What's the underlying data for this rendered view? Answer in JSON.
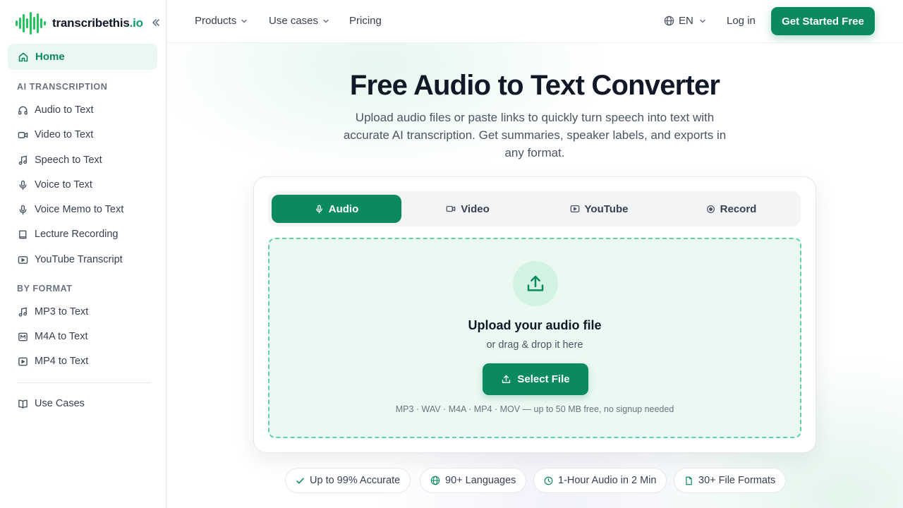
{
  "brand": {
    "name": "transcribethis",
    "tld": ".io"
  },
  "sidebar": {
    "home": "Home",
    "sections": [
      {
        "title": "AI TRANSCRIPTION",
        "items": [
          "Audio to Text",
          "Video to Text",
          "Speech to Text",
          "Voice to Text",
          "Voice Memo to Text",
          "Lecture Recording",
          "YouTube Transcript"
        ]
      },
      {
        "title": "BY FORMAT",
        "items": [
          "MP3 to Text",
          "M4A to Text",
          "MP4 to Text"
        ]
      }
    ],
    "footer_item": "Use Cases"
  },
  "header": {
    "nav": [
      "Products",
      "Use cases",
      "Pricing"
    ],
    "lang": "EN",
    "login": "Log in",
    "cta": "Get Started Free"
  },
  "hero": {
    "title": "Free Audio to Text Converter",
    "subtitle": "Upload audio files or paste links to quickly turn speech into text with accurate AI transcription. Get summaries, speaker labels, and exports in any format."
  },
  "uploader": {
    "tabs": [
      "Audio",
      "Video",
      "YouTube",
      "Record"
    ],
    "active_tab": "Audio",
    "title": "Upload your audio file",
    "subtitle": "or drag & drop it here",
    "button": "Select File",
    "note": "MP3 · WAV · M4A · MP4 · MOV — up to 50 MB free, no signup needed"
  },
  "badges": [
    "Up to 99% Accurate",
    "90+ Languages",
    "1-Hour Audio in 2 Min",
    "30+ File Formats"
  ],
  "colors": {
    "accent": "#0b8a5f",
    "accent_light": "#ebf9f2",
    "dash": "#5fd3a6"
  }
}
